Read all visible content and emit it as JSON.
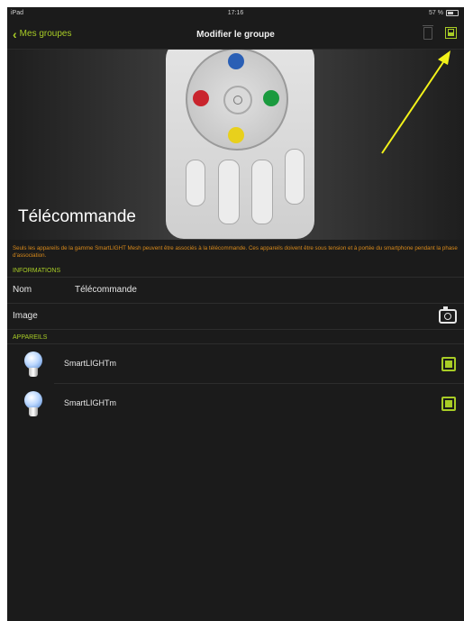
{
  "status_bar": {
    "carrier": "iPad",
    "time": "17:16",
    "battery": "57 %"
  },
  "nav": {
    "back_label": "Mes groupes",
    "title": "Modifier le groupe"
  },
  "hero": {
    "title": "Télécommande"
  },
  "notice": "Seuls les appareils de la gamme SmartLIGHT Mesh peuvent être associés à la télécommande. Ces appareils doivent être sous tension et à portée du smartphone pendant la phase d'association.",
  "informations": {
    "header": "INFORMATIONS",
    "name_label": "Nom",
    "name_value": "Télécommande",
    "image_label": "Image"
  },
  "appareils": {
    "header": "APPAREILS",
    "items": [
      {
        "name": "SmartLIGHTm"
      },
      {
        "name": "SmartLIGHTm"
      }
    ]
  },
  "colors": {
    "accent": "#a8cc26",
    "notice": "#d98a1b",
    "annotation_arrow": "#f2f21a"
  }
}
